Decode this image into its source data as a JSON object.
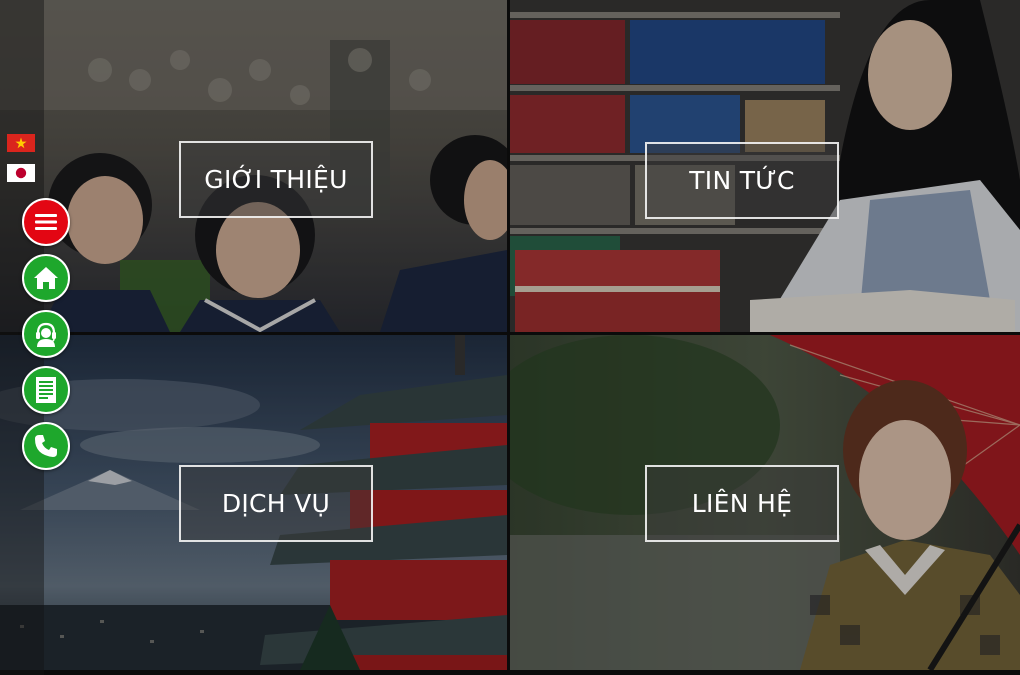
{
  "tiles": [
    {
      "id": "about",
      "label": "GIỚI THIỆU"
    },
    {
      "id": "news",
      "label": "TIN TỨC"
    },
    {
      "id": "services",
      "label": "DỊCH VỤ"
    },
    {
      "id": "contact",
      "label": "LIÊN HỆ"
    }
  ],
  "languages": [
    {
      "code": "vi",
      "icon": "vietnam-flag-icon"
    },
    {
      "code": "ja",
      "icon": "japan-flag-icon"
    }
  ],
  "floating_buttons": [
    {
      "icon": "hamburger-menu-icon",
      "color": "#e30613"
    },
    {
      "icon": "home-icon",
      "color": "#1ea72c"
    },
    {
      "icon": "support-agent-icon",
      "color": "#1ea72c"
    },
    {
      "icon": "document-icon",
      "color": "#1ea72c"
    },
    {
      "icon": "phone-icon",
      "color": "#1ea72c"
    }
  ],
  "colors": {
    "menu_red": "#e30613",
    "action_green": "#1ea72c",
    "label_border": "#ffffff"
  }
}
